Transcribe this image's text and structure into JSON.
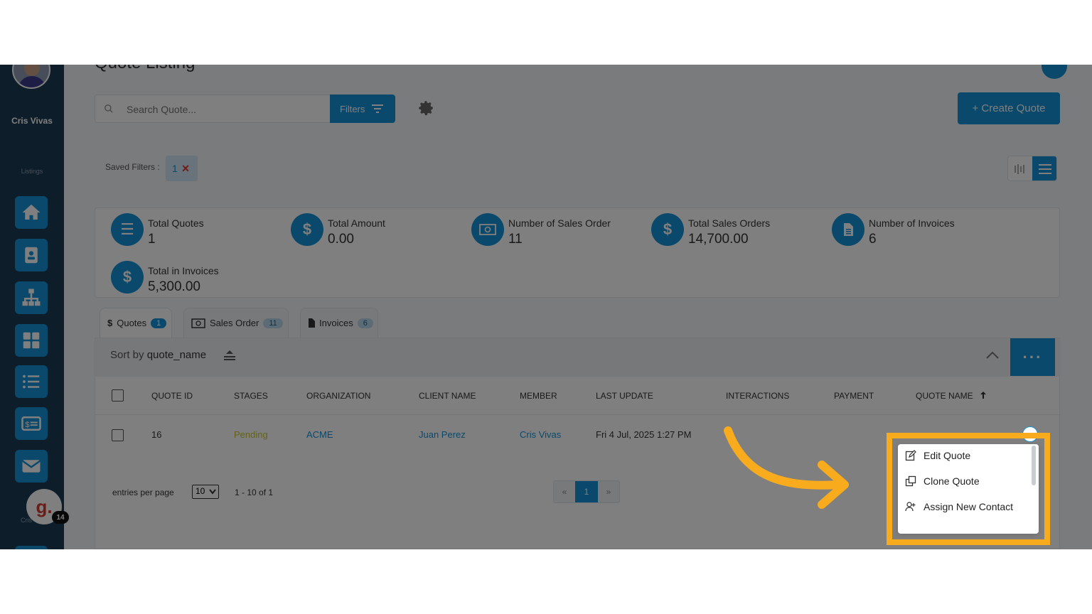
{
  "sidebar": {
    "user_name": "Cris Vivas",
    "section_label": "Listings",
    "footer_label": "Cris",
    "badge_letter": "g.",
    "badge_count": "14",
    "buttons": [
      "home-icon",
      "contact-card-icon",
      "org-chart-icon",
      "grid-icon",
      "list-icon",
      "billing-icon",
      "mail-icon"
    ]
  },
  "header": {
    "title": "Quote Listing",
    "search_placeholder": "Search Quote...",
    "filters_label": "Filters",
    "create_label": "+ Create Quote"
  },
  "saved_filters": {
    "label": "Saved Filters :",
    "count": "1",
    "remove_glyph": "×"
  },
  "stats": [
    {
      "label": "Total Quotes",
      "value": "1",
      "icon": "list-icon"
    },
    {
      "label": "Total Amount",
      "value": "0.00",
      "icon": "dollar-icon"
    },
    {
      "label": "Number of Sales Order",
      "value": "11",
      "icon": "money-icon"
    },
    {
      "label": "Total Sales Orders",
      "value": "14,700.00",
      "icon": "dollar-icon"
    },
    {
      "label": "Number of Invoices",
      "value": "6",
      "icon": "document-icon"
    },
    {
      "label": "Total in Invoices",
      "value": "5,300.00",
      "icon": "dollar-icon"
    }
  ],
  "tabs": [
    {
      "label": "Quotes",
      "count": "1",
      "prefix": "$"
    },
    {
      "label": "Sales Order",
      "count": "11"
    },
    {
      "label": "Invoices",
      "count": "6"
    }
  ],
  "sort": {
    "prefix": "Sort by ",
    "field": "quote_name",
    "more_glyph": "···"
  },
  "columns": [
    "QUOTE ID",
    "STAGES",
    "ORGANIZATION",
    "CLIENT NAME",
    "MEMBER",
    "LAST UPDATE",
    "INTERACTIONS",
    "PAYMENT",
    "QUOTE NAME"
  ],
  "rows": [
    {
      "quote_id": "16",
      "stage": "Pending",
      "organization": "ACME",
      "client_name": "Juan Perez",
      "member": "Cris Vivas",
      "last_update": "Fri 4 Jul, 2025 1:27 PM",
      "interactions": "",
      "payment": "",
      "quote_name": ""
    }
  ],
  "pagination": {
    "entries_label": "entries per page",
    "per_page": "10",
    "range": "1 - 10 of 1",
    "prev": "«",
    "current": "1",
    "next": "»"
  },
  "dropdown": {
    "items": [
      {
        "label": "Edit Quote",
        "icon": "edit-icon"
      },
      {
        "label": "Clone Quote",
        "icon": "clone-icon"
      },
      {
        "label": "Assign New Contact",
        "icon": "assign-contact-icon"
      }
    ]
  },
  "colors": {
    "accent": "#1593d6",
    "sidebar": "#1c3a55",
    "highlight": "#f9ab1e",
    "pending": "#c7c732"
  }
}
